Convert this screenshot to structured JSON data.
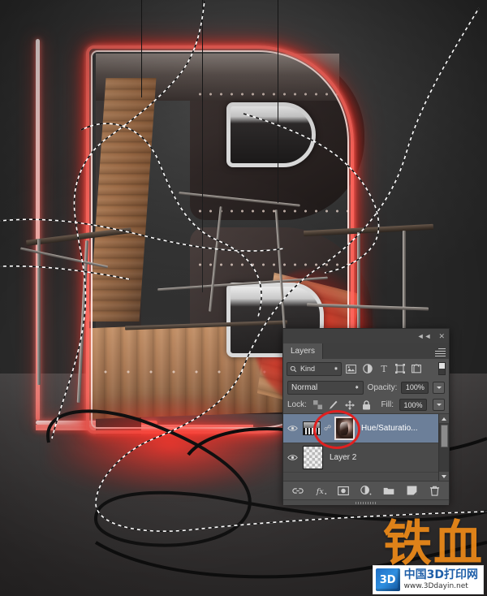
{
  "app": {
    "artwork_description": "3D typographic letter B built from wood planks, dark metal plates and glowing red neon tubing, with marching-ants selection paths and black cables across a grey studio floor"
  },
  "panel": {
    "titlebar": {
      "collapse_label": "◄◄",
      "close_label": "✕",
      "collapse_icon": "collapse-double-arrow-icon",
      "close_icon": "close-icon"
    },
    "tab": {
      "label": "Layers"
    },
    "menu_icon": "panel-menu-icon",
    "filter_row": {
      "search_icon": "search-icon",
      "kind_label": "Kind",
      "spinner_up": "▲",
      "spinner_down": "▼",
      "icons": [
        {
          "name": "filter-pixel-icon",
          "title": "Pixel layers"
        },
        {
          "name": "filter-adjustment-icon",
          "title": "Adjustment layers"
        },
        {
          "name": "filter-type-icon",
          "title": "Type layers",
          "glyph": "T"
        },
        {
          "name": "filter-shape-icon",
          "title": "Shape layers"
        },
        {
          "name": "filter-smart-object-icon",
          "title": "Smart objects"
        }
      ],
      "toggle_name": "filter-enable-toggle"
    },
    "blend_row": {
      "blend_mode": "Normal",
      "opacity_label": "Opacity:",
      "opacity_value": "100%"
    },
    "lock_row": {
      "lock_label": "Lock:",
      "fill_label": "Fill:",
      "fill_value": "100%",
      "locks": [
        {
          "name": "lock-transparent-pixels-icon"
        },
        {
          "name": "lock-image-pixels-icon"
        },
        {
          "name": "lock-position-icon"
        },
        {
          "name": "lock-all-icon"
        }
      ]
    },
    "layers": [
      {
        "name": "Hue/Saturatio...",
        "visible": true,
        "selected": true,
        "thumb": "hue-saturation-adjustment-thumbnail",
        "linked": true,
        "mask_thumb": "layer-mask-thumbnail"
      },
      {
        "name": "Layer 2",
        "visible": true,
        "selected": false,
        "thumb": "transparent-layer-thumbnail"
      }
    ],
    "scrollbar": {
      "up_arrow": "scroll-up-arrow",
      "down_arrow": "scroll-down-arrow"
    },
    "bottom_toolbar": [
      {
        "name": "link-layers-button",
        "title": "Link layers"
      },
      {
        "name": "layer-style-button",
        "title": "Add a layer style",
        "glyph": "fx"
      },
      {
        "name": "add-layer-mask-button",
        "title": "Add layer mask"
      },
      {
        "name": "new-adjustment-layer-button",
        "title": "New fill or adjustment layer"
      },
      {
        "name": "new-group-button",
        "title": "Create a new group"
      },
      {
        "name": "new-layer-button",
        "title": "Create a new layer"
      },
      {
        "name": "delete-layer-button",
        "title": "Delete layer"
      }
    ],
    "grip_name": "panel-resize-grip"
  },
  "annotation": {
    "name": "red-highlight-ellipse",
    "color": "#e02020",
    "target": "layer-mask-thumbnail"
  },
  "watermark": {
    "big_text": "铁血",
    "site_name": "中国3D打印网",
    "url": "www.3Ddayin.net",
    "logo_text": "3D",
    "big_color": "#f28c18",
    "title_color": "#1f5fa8"
  }
}
